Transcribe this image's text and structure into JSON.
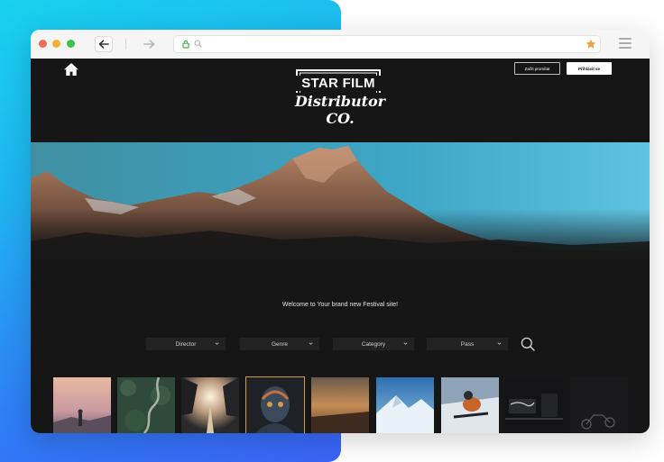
{
  "header": {
    "login_button": "Přihlásit se",
    "secondary_button": "Začít promítat"
  },
  "logo": {
    "line1": "STAR FILM",
    "line2": "Distributor CO."
  },
  "welcome_text": "Welcome to Your brand new Festival site!",
  "filters": [
    {
      "label": "Director"
    },
    {
      "label": "Genre"
    },
    {
      "label": "Category"
    },
    {
      "label": "Pass"
    }
  ],
  "icons": {
    "back": "arrow-left-icon",
    "forward": "arrow-right-icon",
    "lock": "lock-icon",
    "search": "search-icon",
    "star": "star-icon",
    "menu": "hamburger-menu-icon",
    "home": "home-icon"
  },
  "colors": {
    "site_background": "#161616",
    "accent_star": "#f0a040",
    "gradient_start": "#17d2ee",
    "gradient_end": "#3a63f6"
  },
  "gallery": {
    "items": [
      "sunset-hiker",
      "forest-road",
      "bridge-sunset",
      "masked-portrait",
      "desert-dusk",
      "snow-mountain",
      "snowboarder",
      "film-studio",
      "cyclists-dark"
    ]
  }
}
